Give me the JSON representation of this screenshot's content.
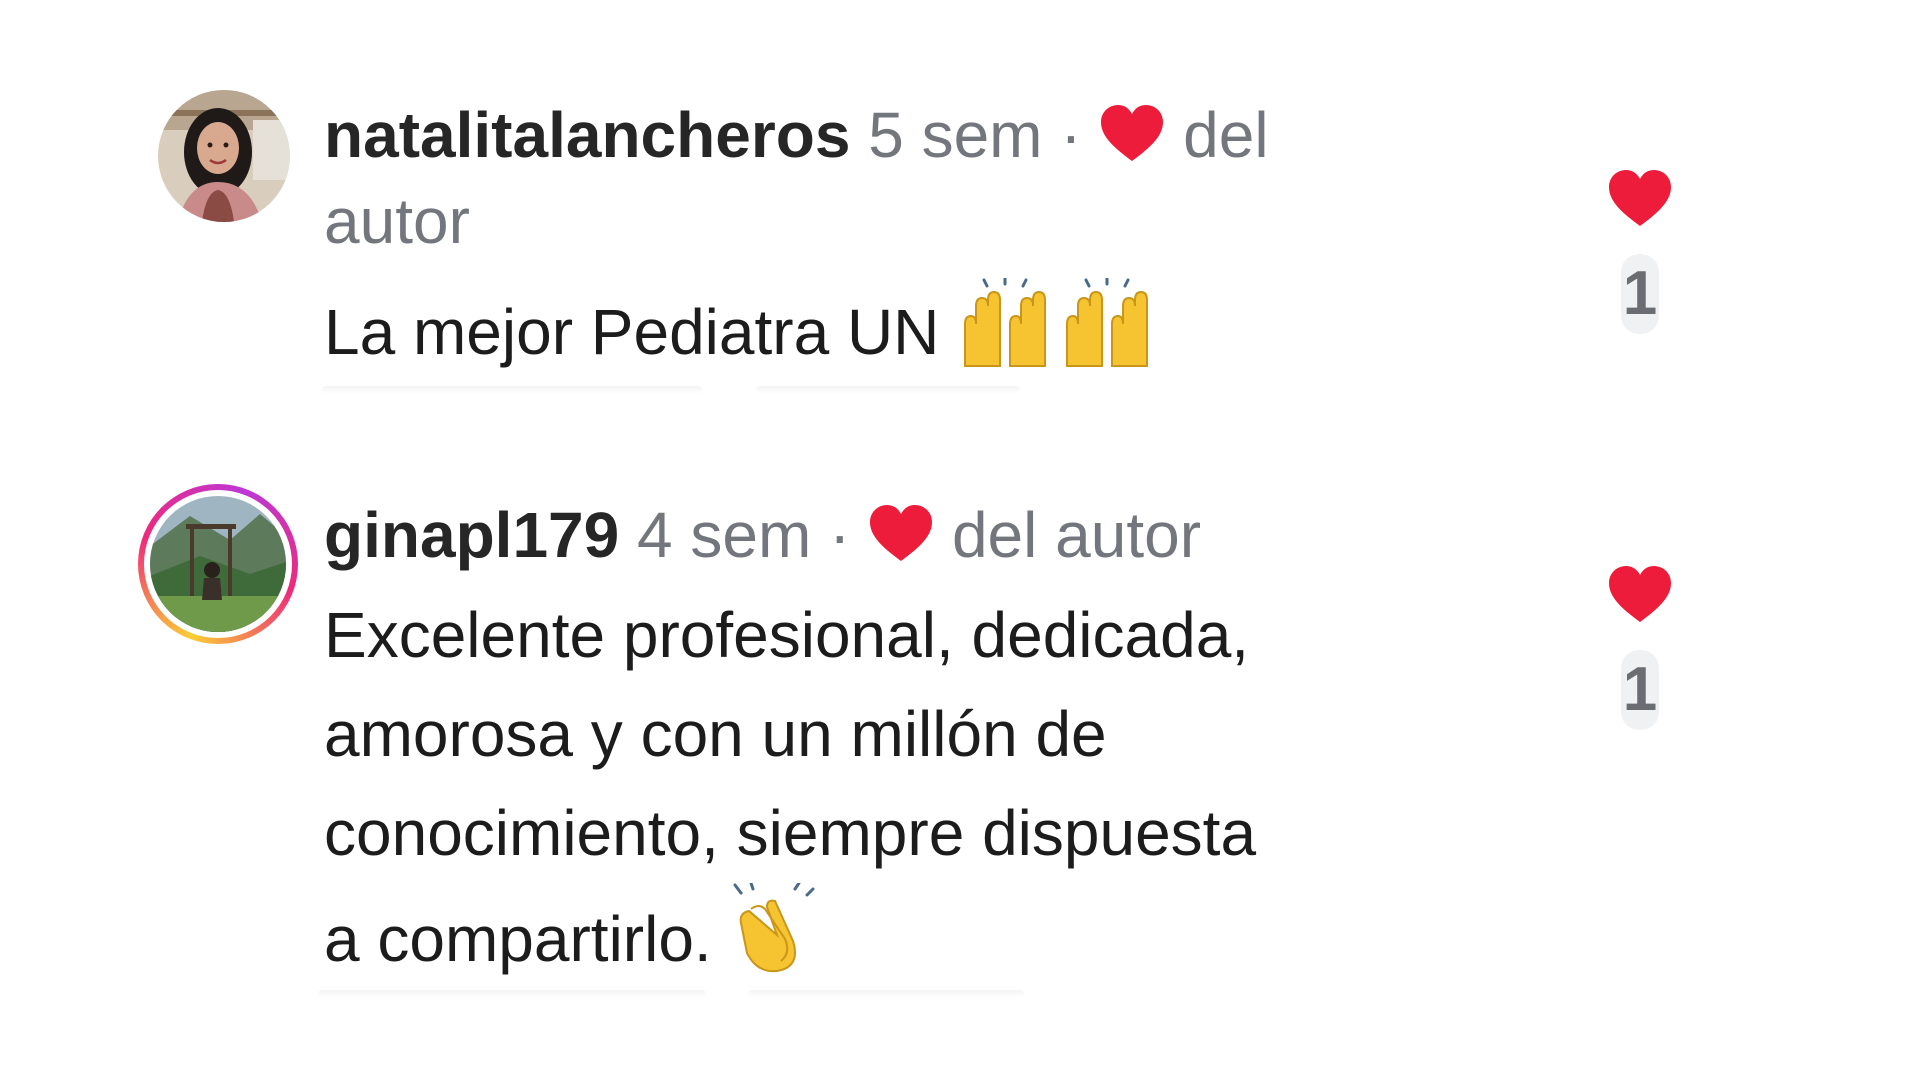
{
  "comments": [
    {
      "username": "natalitalancheros",
      "time": "5 sem",
      "separator": "·",
      "author_like_prefix": "del",
      "author_like_suffix": "autor",
      "text": "La mejor Pediatra UN",
      "emoji": "raising-hands-icon",
      "like_count": "1",
      "has_story_ring": false
    },
    {
      "username": "ginapl179",
      "time": "4 sem",
      "separator": "·",
      "author_like_text": "del autor",
      "text_lines": [
        "Excelente profesional, dedicada,",
        "amorosa y con un millón de",
        "conocimiento, siempre dispuesta",
        "a compartirlo."
      ],
      "emoji": "clapping-hands-icon",
      "like_count": "1",
      "has_story_ring": true
    }
  ],
  "colors": {
    "heart": "#ed1c3a",
    "meta_gray": "#73777d",
    "text": "#1c1c1c",
    "story_ring_start": "#f9ce34",
    "story_ring_mid": "#ee2a7b",
    "story_ring_end": "#bc37d6"
  }
}
